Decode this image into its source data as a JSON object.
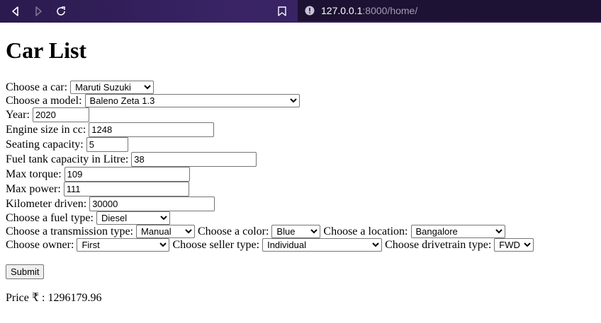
{
  "browser": {
    "url_host": "127.0.0.1",
    "url_rest": ":8000/home/"
  },
  "page": {
    "title": "Car List"
  },
  "form": {
    "car": {
      "label": "Choose a car:",
      "value": "Maruti Suzuki"
    },
    "model": {
      "label": "Choose a model:",
      "value": "Baleno Zeta 1.3"
    },
    "year": {
      "label": "Year:",
      "value": "2020"
    },
    "engine": {
      "label": "Engine size in cc:",
      "value": "1248"
    },
    "seating": {
      "label": "Seating capacity:",
      "value": "5"
    },
    "fuel_tank": {
      "label": "Fuel tank capacity in Litre:",
      "value": "38"
    },
    "torque": {
      "label": "Max torque:",
      "value": "109"
    },
    "power": {
      "label": "Max power:",
      "value": "111"
    },
    "km": {
      "label": "Kilometer driven:",
      "value": "30000"
    },
    "fuel_type": {
      "label": "Choose a fuel type:",
      "value": "Diesel"
    },
    "transmission": {
      "label": "Choose a transmission type:",
      "value": "Manual"
    },
    "color": {
      "label": "Choose a color:",
      "value": "Blue"
    },
    "location": {
      "label": "Choose a location:",
      "value": "Bangalore"
    },
    "owner": {
      "label": "Choose owner:",
      "value": "First"
    },
    "seller": {
      "label": "Choose seller type:",
      "value": "Individual"
    },
    "drivetrain": {
      "label": "Choose drivetrain type:",
      "value": "FWD"
    },
    "submit_label": "Submit"
  },
  "result": {
    "label": "Price ₹ :",
    "value": "1296179.96"
  }
}
